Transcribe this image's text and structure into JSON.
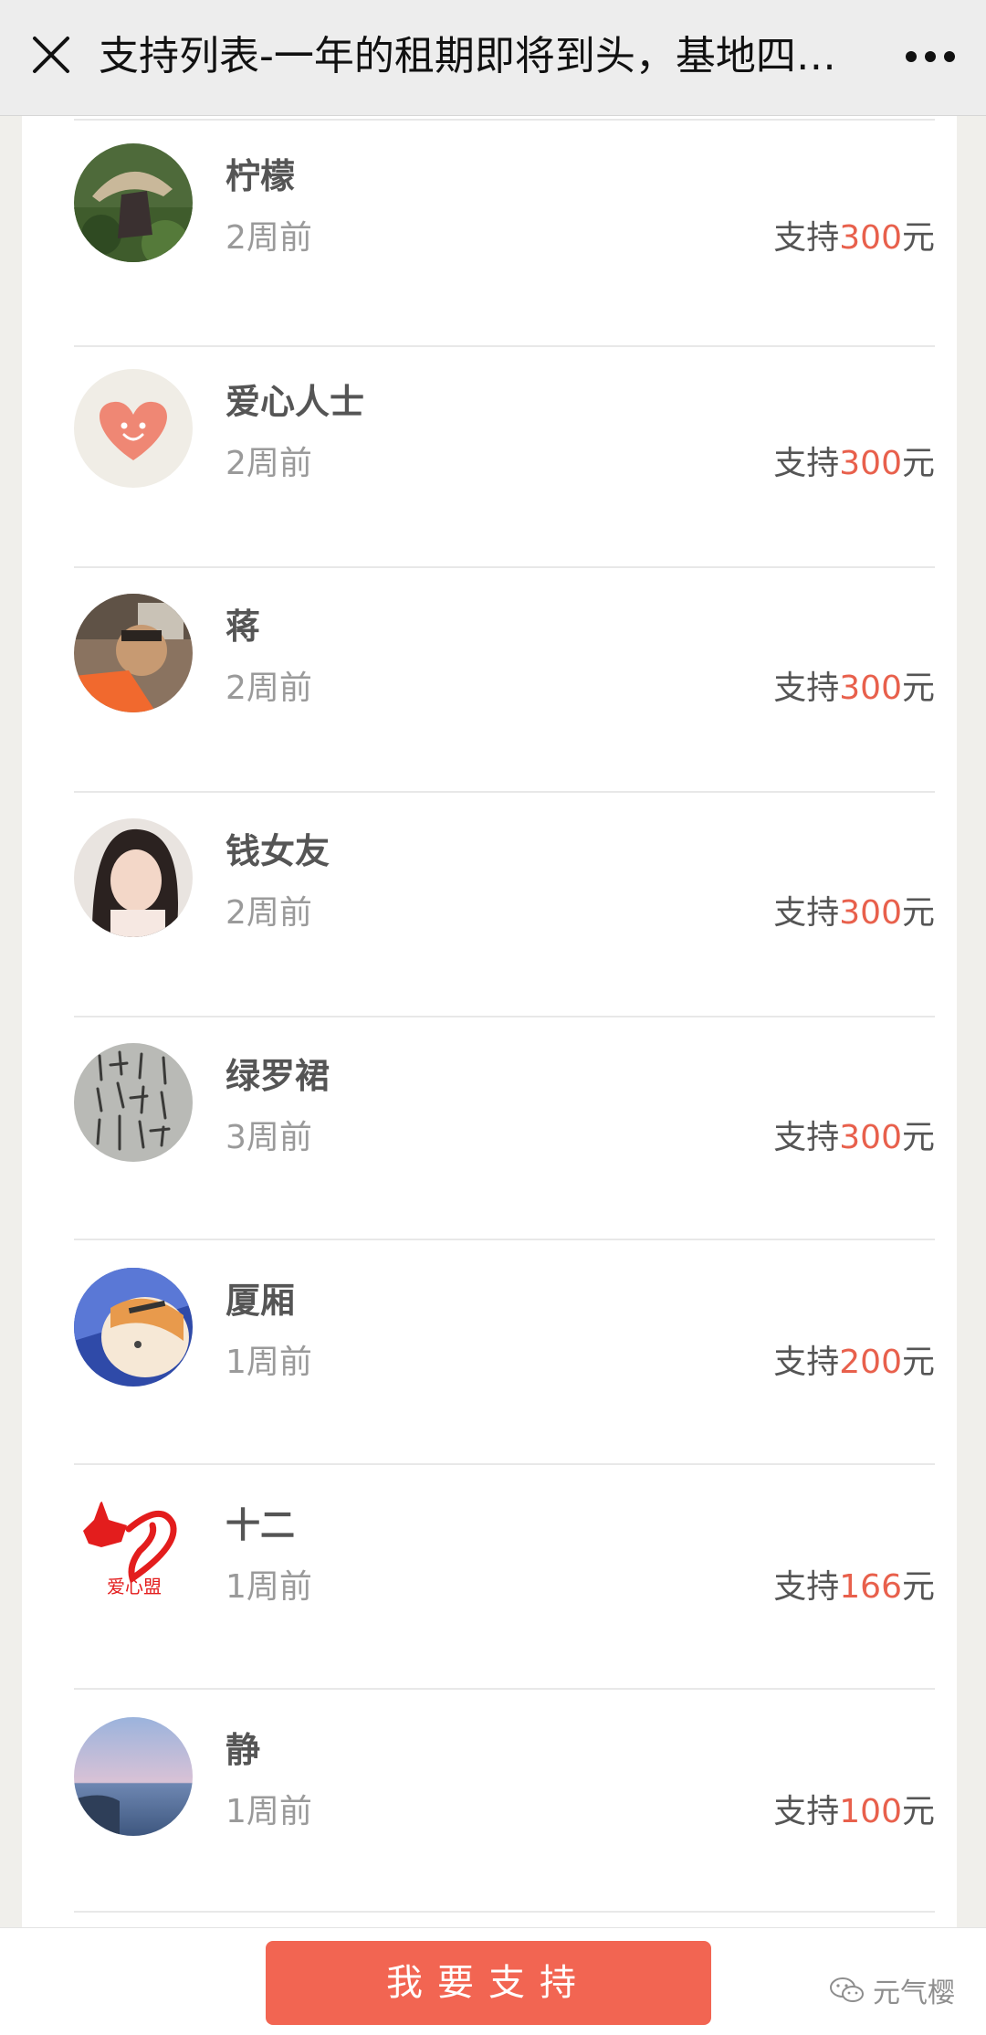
{
  "header": {
    "title": "支持列表-一年的租期即将到头，基地四…",
    "close_icon": "close-icon",
    "more_icon": "more-icon"
  },
  "supporters": [
    {
      "name": "柠檬",
      "time": "2周前",
      "prefix": "支持",
      "amount": "300",
      "unit": "元",
      "avatar": "straw-hat-photo"
    },
    {
      "name": "爱心人士",
      "time": "2周前",
      "prefix": "支持",
      "amount": "300",
      "unit": "元",
      "avatar": "heart-smile"
    },
    {
      "name": "蒋",
      "time": "2周前",
      "prefix": "支持",
      "amount": "300",
      "unit": "元",
      "avatar": "child-photo"
    },
    {
      "name": "钱女友",
      "time": "2周前",
      "prefix": "支持",
      "amount": "300",
      "unit": "元",
      "avatar": "woman-photo"
    },
    {
      "name": "绿罗裙",
      "time": "3周前",
      "prefix": "支持",
      "amount": "300",
      "unit": "元",
      "avatar": "calligraphy-photo"
    },
    {
      "name": "厦厢",
      "time": "1周前",
      "prefix": "支持",
      "amount": "200",
      "unit": "元",
      "avatar": "cat-photo"
    },
    {
      "name": "十二",
      "time": "1周前",
      "prefix": "支持",
      "amount": "166",
      "unit": "元",
      "avatar": "dog-heart-logo",
      "logo_text": "爱心盟"
    },
    {
      "name": "静",
      "time": "1周前",
      "prefix": "支持",
      "amount": "100",
      "unit": "元",
      "avatar": "sea-photo"
    }
  ],
  "footer": {
    "support_button": "我要支持",
    "watermark": "元气樱",
    "watermark_icon": "wechat-icon"
  },
  "colors": {
    "accent": "#f26552",
    "amount": "#e8604c"
  }
}
